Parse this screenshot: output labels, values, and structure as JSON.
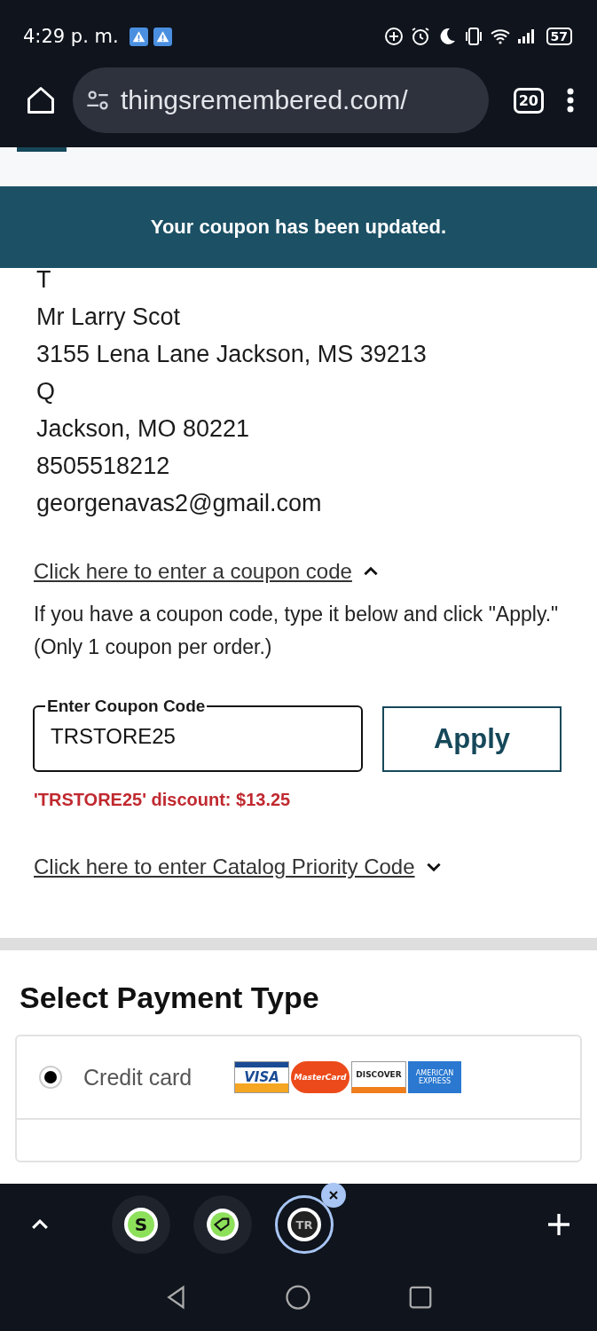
{
  "status_bar": {
    "time": "4:29 p. m.",
    "battery": "57"
  },
  "browser": {
    "url": "thingsremembered.com/",
    "tab_count": "20"
  },
  "banner": {
    "message": "Your coupon has been updated."
  },
  "billing": {
    "lines": [
      "T",
      "Mr Larry Scot",
      "3155 Lena Lane Jackson, MS 39213",
      "Q",
      "Jackson, MO 80221",
      "8505518212",
      "georgenavas2@gmail.com"
    ]
  },
  "coupon": {
    "link": "Click here to enter a coupon code",
    "expanded": true,
    "help": "If you have a coupon code, type it below and click \"Apply.\" (Only 1 coupon per order.)",
    "field_label": "Enter Coupon Code",
    "value": "TRSTORE25",
    "apply": "Apply",
    "discount": "'TRSTORE25' discount: $13.25"
  },
  "catalog": {
    "link": "Click here to enter Catalog Priority Code",
    "expanded": false
  },
  "payment": {
    "title": "Select Payment Type",
    "options": [
      {
        "label": "Credit card",
        "selected": true,
        "cards": [
          {
            "kind": "visa",
            "text": "VISA"
          },
          {
            "kind": "mastercard",
            "text": "MasterCard"
          },
          {
            "kind": "discover",
            "text": "DISCOVER"
          },
          {
            "kind": "amex",
            "text": "AMERICAN EXPRESS"
          }
        ]
      }
    ]
  },
  "tab_group": {
    "tabs": [
      {
        "kind": "s",
        "text": "S",
        "selected": false
      },
      {
        "kind": "tag",
        "selected": false
      },
      {
        "kind": "tr",
        "text": "TR",
        "selected": true
      }
    ]
  }
}
